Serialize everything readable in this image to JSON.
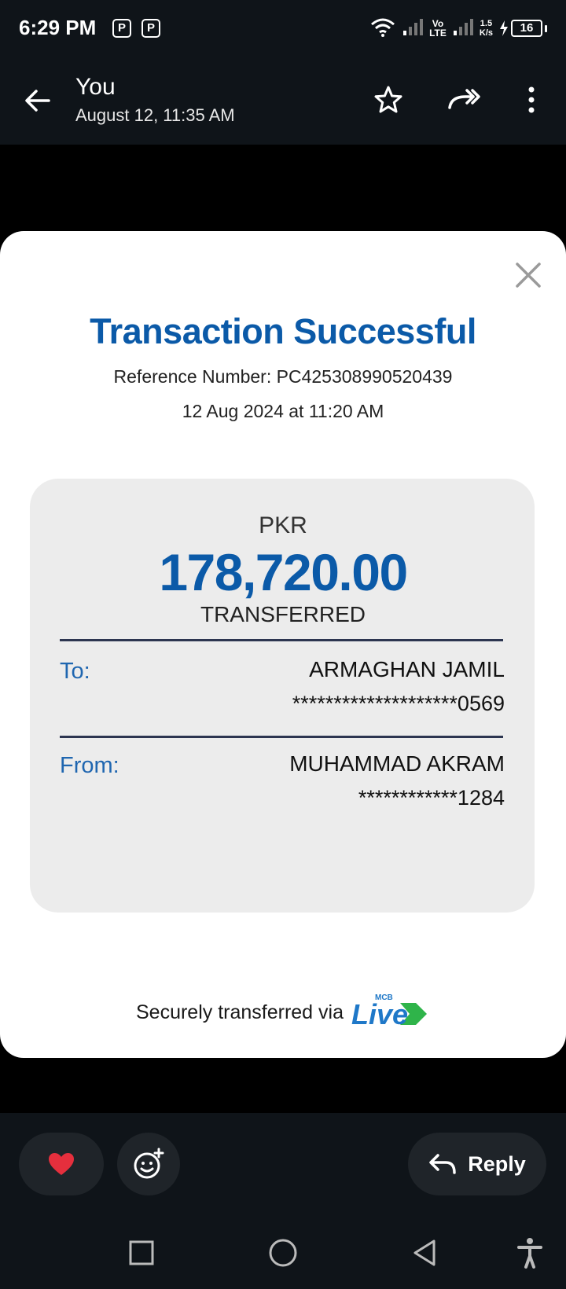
{
  "status_bar": {
    "time": "6:29 PM",
    "notification_icons": [
      "P",
      "P"
    ],
    "network": "Vo LTE",
    "net_top": "Vo",
    "net_bottom": "LTE",
    "speed_value": "1.5",
    "speed_unit": "K/s",
    "battery": "16",
    "icons": [
      "wifi-icon",
      "signal-icon",
      "signal-icon",
      "charging-icon",
      "battery-icon"
    ]
  },
  "header": {
    "title": "You",
    "subtitle": "August 12, 11:35 AM",
    "icons": [
      "back-arrow-icon",
      "star-icon",
      "forward-icon",
      "more-vertical-icon"
    ]
  },
  "receipt": {
    "title": "Transaction Successful",
    "reference": "Reference Number: PC425308990520439",
    "datetime": "12 Aug 2024 at 11:20 AM",
    "currency": "PKR",
    "amount": "178,720.00",
    "status": "TRANSFERRED",
    "to_label": "To:",
    "to_name": "ARMAGHAN JAMIL",
    "to_account": "********************0569",
    "from_label": "From:",
    "from_name": "MUHAMMAD AKRAM",
    "from_account": "************1284",
    "footer": "Securely transferred via",
    "brand_main": "Live",
    "brand_top": "MCB"
  },
  "actions": {
    "reply_label": "Reply",
    "icons": [
      "heart-icon",
      "add-emoji-icon",
      "reply-icon"
    ]
  },
  "colors": {
    "accent_blue": "#0b5aa8",
    "label_blue": "#1f66b0",
    "bar_bg": "#0f1419",
    "pill_bg": "#1f2429",
    "panel_bg": "#ececec",
    "heart": "#e52f3d"
  }
}
